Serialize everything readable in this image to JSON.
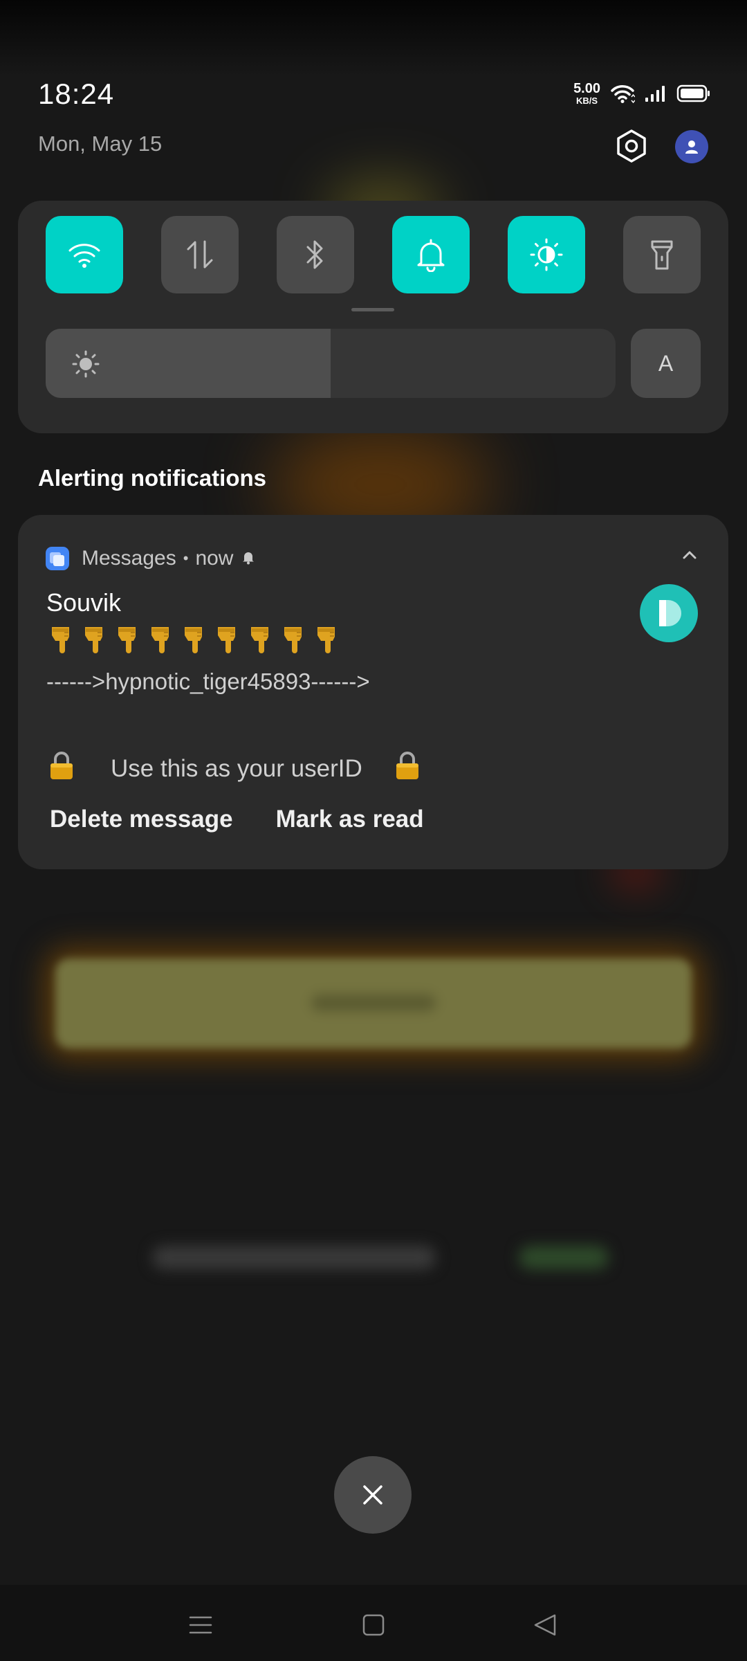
{
  "status_bar": {
    "time": "18:24",
    "date": "Mon, May 15",
    "net_speed_value": "5.00",
    "net_speed_unit": "KB/S",
    "icons": [
      "wifi-icon",
      "signal-icon",
      "battery-icon"
    ]
  },
  "header_actions": {
    "settings_icon": "settings-hexagon-icon",
    "avatar_icon": "user-avatar-icon"
  },
  "quick_settings": {
    "tiles": [
      {
        "name": "wifi",
        "icon": "wifi-icon",
        "active": true
      },
      {
        "name": "mobile-data",
        "icon": "data-transfer-icon",
        "active": false
      },
      {
        "name": "bluetooth",
        "icon": "bluetooth-icon",
        "active": false
      },
      {
        "name": "sound",
        "icon": "bell-icon",
        "active": true
      },
      {
        "name": "dark-mode",
        "icon": "contrast-icon",
        "active": true
      },
      {
        "name": "flashlight",
        "icon": "flashlight-icon",
        "active": false
      }
    ],
    "brightness_level": 0.5,
    "auto_brightness_label": "A"
  },
  "notifications": {
    "section_title": "Alerting notifications",
    "items": [
      {
        "app_name": "Messages",
        "time": "now",
        "sender": "Souvik",
        "emoji_count": 9,
        "line2": "------>hypnotic_tiger45893------>",
        "line3": "Use this as your userID",
        "actions": [
          "Delete message",
          "Mark as read"
        ]
      }
    ]
  },
  "colors": {
    "accent": "#00d2c6",
    "panel": "#2b2b2b",
    "tile_off": "#4a4a4a",
    "avatar_blue": "#3f51b5",
    "contact_avatar": "#1fc0b6"
  },
  "nav_bar": {
    "buttons": [
      "menu-icon",
      "home-icon",
      "back-icon"
    ]
  }
}
